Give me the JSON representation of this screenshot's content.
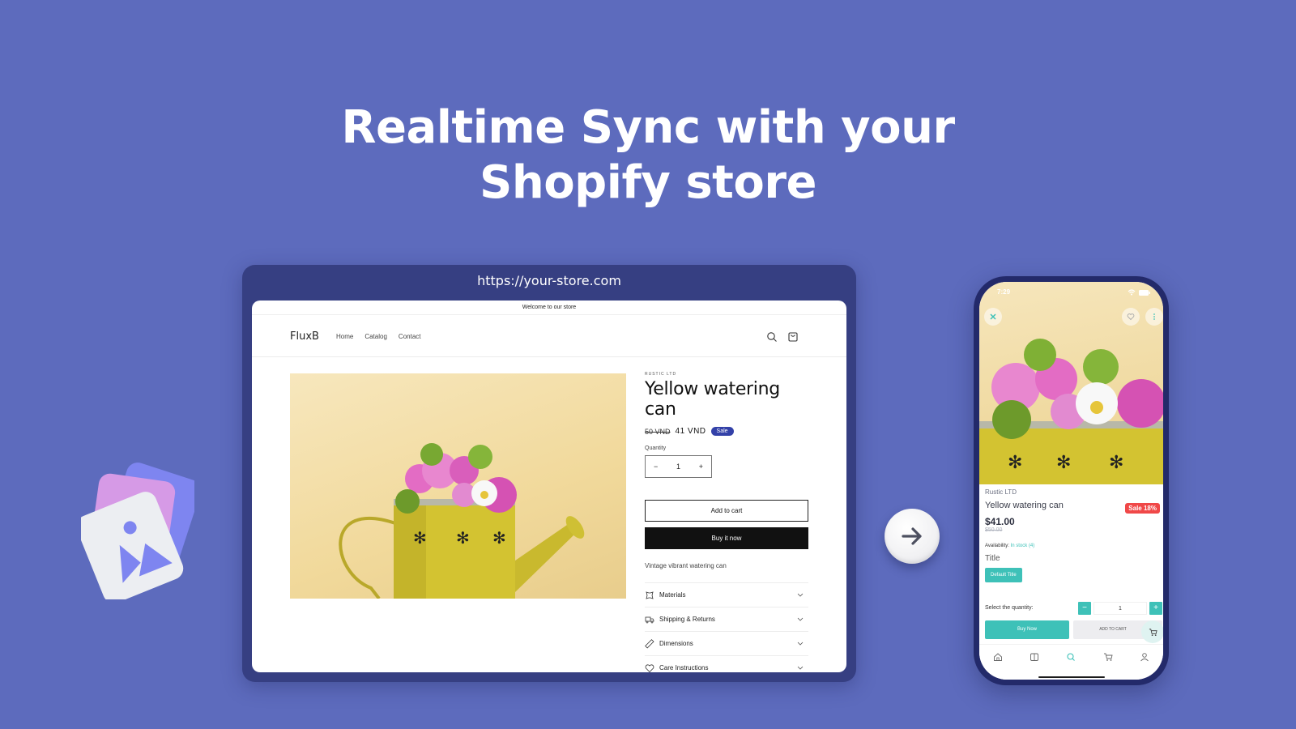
{
  "headline": {
    "line1": "Realtime Sync with your",
    "line2": "Shopify store"
  },
  "colors": {
    "background": "#5d6bbd",
    "browser_frame": "#363f82",
    "sale_badge": "#3341a8",
    "phone_accent": "#3ec1b8",
    "phone_sale": "#f04848"
  },
  "browser": {
    "url": "https://your-store.com",
    "announcement": "Welcome to our store",
    "store": {
      "logo": "FluxB",
      "nav": [
        "Home",
        "Catalog",
        "Contact"
      ],
      "icons": [
        "search-icon",
        "cart-icon"
      ]
    },
    "product": {
      "vendor": "RUSTIC LTD",
      "title": "Yellow watering can",
      "old_price": "50 VND",
      "price": "41 VND",
      "sale_label": "Sale",
      "quantity_label": "Quantity",
      "quantity": "1",
      "minus": "−",
      "plus": "+",
      "add_to_cart": "Add to cart",
      "buy_now": "Buy it now",
      "description": "Vintage vibrant watering can",
      "accordion": [
        {
          "label": "Materials",
          "icon": "leather-icon"
        },
        {
          "label": "Shipping & Returns",
          "icon": "truck-icon"
        },
        {
          "label": "Dimensions",
          "icon": "ruler-icon"
        },
        {
          "label": "Care Instructions",
          "icon": "heart-icon"
        }
      ]
    }
  },
  "phone": {
    "time": "7:29",
    "vendor": "Rustic LTD",
    "title": "Yellow watering can",
    "sale_badge": "Sale 18%",
    "price": "$41.00",
    "old_price": "$50.00",
    "availability_label": "Availability:",
    "availability_value": "In stock",
    "availability_count": "(4)",
    "option_title": "Title",
    "option_value": "Default Title",
    "quantity_label": "Select the quantity:",
    "quantity": "1",
    "minus": "−",
    "plus": "+",
    "buy_now": "Buy Now",
    "add_to_cart": "ADD TO CART",
    "tabs": [
      "home-icon",
      "catalog-icon",
      "search-icon",
      "cart-icon",
      "profile-icon"
    ]
  }
}
